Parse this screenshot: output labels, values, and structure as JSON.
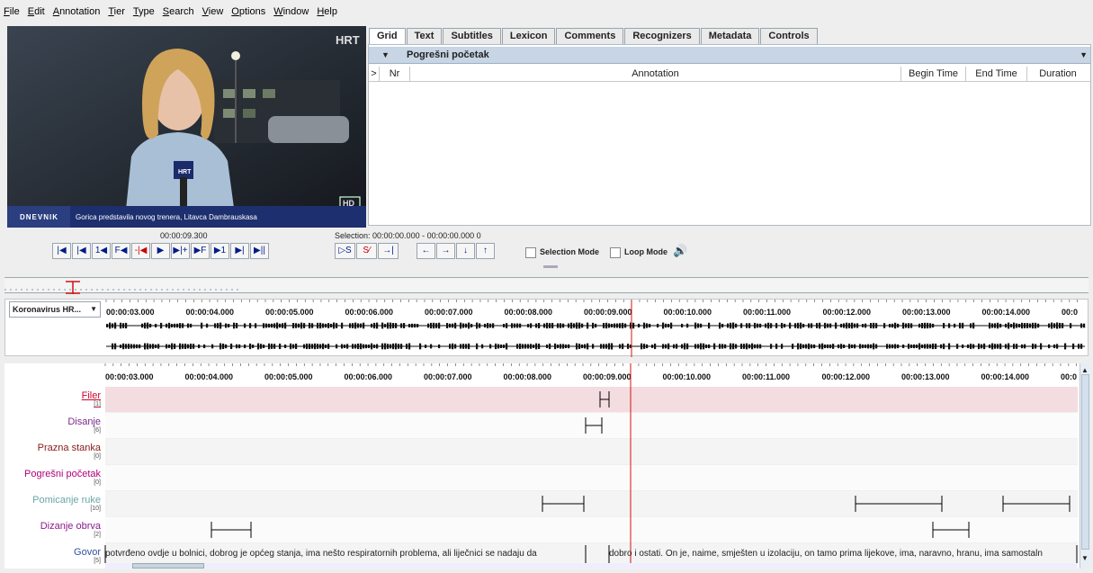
{
  "menu": [
    "File",
    "Edit",
    "Annotation",
    "Tier",
    "Type",
    "Search",
    "View",
    "Options",
    "Window",
    "Help"
  ],
  "video": {
    "logo": "HRT",
    "hd": "HD",
    "show": "DNEVNIK",
    "caption": "Gorica predstavila novog trenera, Litavca Dambrauskasa",
    "mic": "HRT"
  },
  "tabs": [
    "Grid",
    "Text",
    "Subtitles",
    "Lexicon",
    "Comments",
    "Recognizers",
    "Metadata",
    "Controls"
  ],
  "grid": {
    "tier": "Pogrešni početak",
    "columns": [
      ">",
      "Nr",
      "Annotation",
      "Begin Time",
      "End Time",
      "Duration"
    ]
  },
  "controls": {
    "current_time": "00:00:09.300",
    "selection": "Selection: 00:00:00.000 - 00:00:00.000  0",
    "buttons": [
      "|◀",
      "|◀",
      "1◀",
      "F◀",
      "-|◀",
      "▶",
      "▶|+",
      "▶F",
      "▶1",
      "▶|",
      "▶||"
    ],
    "sel_buttons": [
      "▷S",
      "S⁄",
      "→|"
    ],
    "nav_buttons": [
      "←",
      "→",
      "↓",
      "↑"
    ],
    "selection_mode": "Selection Mode",
    "loop_mode": "Loop Mode"
  },
  "waveform": {
    "media": "Koronavirus HR...",
    "ticks": [
      "00:00:03.000",
      "00:00:04.000",
      "00:00:05.000",
      "00:00:06.000",
      "00:00:07.000",
      "00:00:08.000",
      "00:00:09.000",
      "00:00:10.000",
      "00:00:11.000",
      "00:00:12.000",
      "00:00:13.000",
      "00:00:14.000",
      "00:0"
    ]
  },
  "tiers": [
    {
      "name": "Filer",
      "count": "[1]",
      "color": "#d0002a"
    },
    {
      "name": "Disanje",
      "count": "[6]",
      "color": "#7a2a8a"
    },
    {
      "name": "Prazna stanka",
      "count": "[0]",
      "color": "#8a1a1a"
    },
    {
      "name": "Pogrešni početak",
      "count": "[0]",
      "color": "#b0007a"
    },
    {
      "name": "Pomicanje ruke",
      "count": "[10]",
      "color": "#6aa6a6"
    },
    {
      "name": "Dizanje obrva",
      "count": "[2]",
      "color": "#8a1a8a"
    },
    {
      "name": "Govor",
      "count": "[5]",
      "color": "#3050a0"
    }
  ],
  "govor": {
    "seg1": "potvrđeno ovdje u bolnici, dobrog je općeg stanja, ima nešto respiratornih problema, ali liječnici se nadaju da",
    "seg2": "dobro i ostati. On je, naime, smješten u izolaciju, on tamo prima lijekove, ima, naravno, hranu, ima samostaln"
  }
}
